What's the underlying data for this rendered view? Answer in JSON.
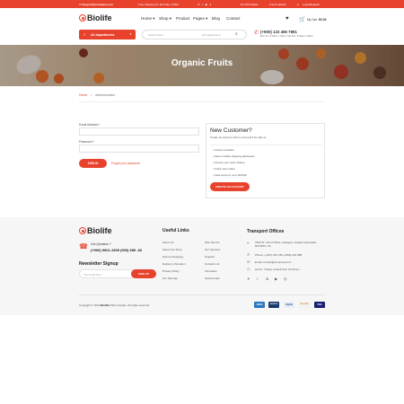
{
  "topbar": {
    "email": "Support@company.com",
    "promo": "Free Shipping for all Order of $90",
    "currency": "$ (USD Dollar)",
    "language": "French (EUR)",
    "account": "Login/Register"
  },
  "header": {
    "logo": "Biolife",
    "nav": [
      "Home ▾",
      "Shop ▾",
      "Product",
      "Pages ▾",
      "Blog",
      "Contact"
    ],
    "cart_label": "My Cart",
    "cart_total": "$0.00"
  },
  "search": {
    "departments": "All departments",
    "placeholder": "Search here...",
    "category": "All Categories ▾",
    "phone": "(+900) 123 456 7891",
    "hours": "Mon-Fri: 8:30am-7:30pm; Sat-Sun: 9:30am-4:30pm"
  },
  "hero": {
    "title": "Organic Fruits"
  },
  "breadcrumb": {
    "home": "Home",
    "current": "Authentication"
  },
  "login": {
    "email_label": "Email Address:*",
    "password_label": "Password:*",
    "signin": "SIGN IN",
    "forgot": "Forgot your password"
  },
  "new_customer": {
    "title": "New Customer?",
    "subtitle": "Create an account with us and you'll be able to:",
    "benefits": [
      "Check out faster",
      "Save multiple shipping addresses",
      "Access your order history",
      "Track new orders",
      "Save items to your Wishlist"
    ],
    "button": "CREATE AN ACCOUNT"
  },
  "footer": {
    "logo": "Biolife",
    "question": "Got Question ?",
    "phones": "(+900) 9001-1909 (900) 689 -66",
    "newsletter": "Newsletter Signup",
    "newsletter_placeholder": "Your email here...",
    "signup": "SIGN UP",
    "useful_title": "Useful Links",
    "links_a": [
      "About Us",
      "About Our Shop",
      "Secure Shopping",
      "Delivery infomation",
      "Privacy Policy",
      "Our Sitemap"
    ],
    "links_b": [
      "Who We Are",
      "Our Services",
      "Projects",
      "Contacts Us",
      "Innovation",
      "Testimonials"
    ],
    "transport_title": "Transport Offices",
    "address": "7563 St. Vicent Place, Glasgow, Greater Newcastle",
    "address_line2": "8t176NN, US",
    "phone": "Phone: (+067) 234 789  (+068) 222 888",
    "email": "Email:  contact@company.com",
    "hours": "Hours:  7 Days a week from 10:00 am",
    "copyright_pre": "Copyright © 2018 ",
    "copyright_brand": "Biolife",
    "copyright_post": " PSD template. All rights reserved",
    "payments": [
      "AMEX",
      "MASTER",
      "PayPal",
      "DISCOVER",
      "VISA"
    ]
  },
  "colors": {
    "accent": "#e8412c"
  }
}
